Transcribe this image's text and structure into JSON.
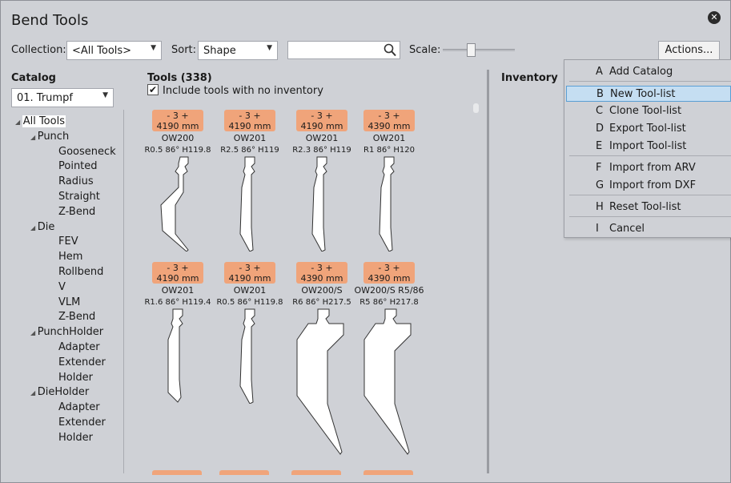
{
  "window": {
    "title": "Bend Tools",
    "close_icon": "close-icon"
  },
  "toolbar": {
    "collection_label": "Collection:",
    "collection_value": "<All Tools>",
    "sort_label": "Sort:",
    "sort_value": "Shape",
    "search_value": "",
    "scale_label": "Scale:",
    "scale_level": 0.4,
    "actions_label": "Actions..."
  },
  "catalog": {
    "header": "Catalog",
    "selected": "01. Trumpf",
    "tree": [
      {
        "label": "All Tools",
        "level": 0,
        "expander": true,
        "selected": true
      },
      {
        "label": "Punch",
        "level": 1,
        "expander": true
      },
      {
        "label": "Gooseneck",
        "level": 2
      },
      {
        "label": "Pointed",
        "level": 2
      },
      {
        "label": "Radius",
        "level": 2
      },
      {
        "label": "Straight",
        "level": 2
      },
      {
        "label": "Z-Bend",
        "level": 2
      },
      {
        "label": "Die",
        "level": 1,
        "expander": true
      },
      {
        "label": "FEV",
        "level": 2
      },
      {
        "label": "Hem",
        "level": 2
      },
      {
        "label": "Rollbend",
        "level": 2
      },
      {
        "label": "V",
        "level": 2
      },
      {
        "label": "VLM",
        "level": 2
      },
      {
        "label": "Z-Bend",
        "level": 2
      },
      {
        "label": "PunchHolder",
        "level": 1,
        "expander": true
      },
      {
        "label": "Adapter",
        "level": 2
      },
      {
        "label": "Extender",
        "level": 2
      },
      {
        "label": "Holder",
        "level": 2
      },
      {
        "label": "DieHolder",
        "level": 1,
        "expander": true
      },
      {
        "label": "Adapter",
        "level": 2
      },
      {
        "label": "Extender",
        "level": 2
      },
      {
        "label": "Holder",
        "level": 2
      }
    ]
  },
  "tools": {
    "header": "Tools (338)",
    "include_label": "Include tools with no inventory",
    "include_checked": true,
    "items": [
      {
        "badge_top": "- 3 +",
        "length": "4190 mm",
        "name": "OW200",
        "spec": "R0.5  86°  H119.8",
        "shape": "gooseneck"
      },
      {
        "badge_top": "- 3 +",
        "length": "4190 mm",
        "name": "OW201",
        "spec": "R2.5  86°  H119",
        "shape": "narrow"
      },
      {
        "badge_top": "- 3 +",
        "length": "4190 mm",
        "name": "OW201",
        "spec": "R2.3  86°  H119",
        "shape": "narrow"
      },
      {
        "badge_top": "- 3 +",
        "length": "4390 mm",
        "name": "OW201",
        "spec": "R1  86°  H120",
        "shape": "narrow"
      },
      {
        "badge_top": "- 3 +",
        "length": "4190 mm",
        "name": "OW201",
        "spec": "R1.6  86°  H119.4",
        "shape": "straight"
      },
      {
        "badge_top": "- 3 +",
        "length": "4190 mm",
        "name": "OW201",
        "spec": "R0.5  86°  H119.8",
        "shape": "narrow"
      },
      {
        "badge_top": "- 3 +",
        "length": "4390 mm",
        "name": "OW200/S",
        "spec": "R6  86°  H217.5",
        "shape": "tall"
      },
      {
        "badge_top": "- 3 +",
        "length": "4390 mm",
        "name": "OW200/S R5/86",
        "spec": "R5  86°  H217.8",
        "shape": "tall"
      }
    ]
  },
  "inventory": {
    "header": "Inventory"
  },
  "menu": {
    "items": [
      {
        "key": "A",
        "label": "Add Catalog"
      },
      {
        "key": "B",
        "label": "New Tool-list",
        "highlighted": true
      },
      {
        "key": "C",
        "label": "Clone Tool-list"
      },
      {
        "key": "D",
        "label": "Export Tool-list"
      },
      {
        "key": "E",
        "label": "Import Tool-list"
      },
      {
        "key": "F",
        "label": "Import from ARV"
      },
      {
        "key": "G",
        "label": "Import from DXF"
      },
      {
        "key": "H",
        "label": "Reset Tool-list"
      },
      {
        "key": "I",
        "label": "Cancel"
      }
    ]
  }
}
